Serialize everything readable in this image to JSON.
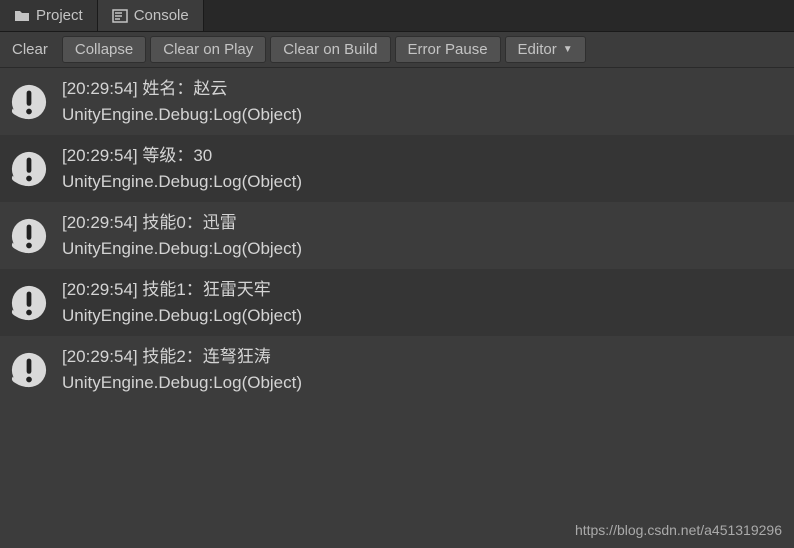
{
  "tabs": [
    {
      "label": "Project",
      "active": false
    },
    {
      "label": "Console",
      "active": true
    }
  ],
  "toolbar": {
    "clear": "Clear",
    "collapse": "Collapse",
    "clear_on_play": "Clear on Play",
    "clear_on_build": "Clear on Build",
    "error_pause": "Error Pause",
    "editor": "Editor"
  },
  "logs": [
    {
      "timestamp": "[20:29:54]",
      "message": "姓名：赵云",
      "trace": "UnityEngine.Debug:Log(Object)"
    },
    {
      "timestamp": "[20:29:54]",
      "message": "等级：30",
      "trace": "UnityEngine.Debug:Log(Object)"
    },
    {
      "timestamp": "[20:29:54]",
      "message": "技能0：迅雷",
      "trace": "UnityEngine.Debug:Log(Object)"
    },
    {
      "timestamp": "[20:29:54]",
      "message": "技能1：狂雷天牢",
      "trace": "UnityEngine.Debug:Log(Object)"
    },
    {
      "timestamp": "[20:29:54]",
      "message": "技能2：连弩狂涛",
      "trace": "UnityEngine.Debug:Log(Object)"
    }
  ],
  "watermark": "https://blog.csdn.net/a451319296"
}
